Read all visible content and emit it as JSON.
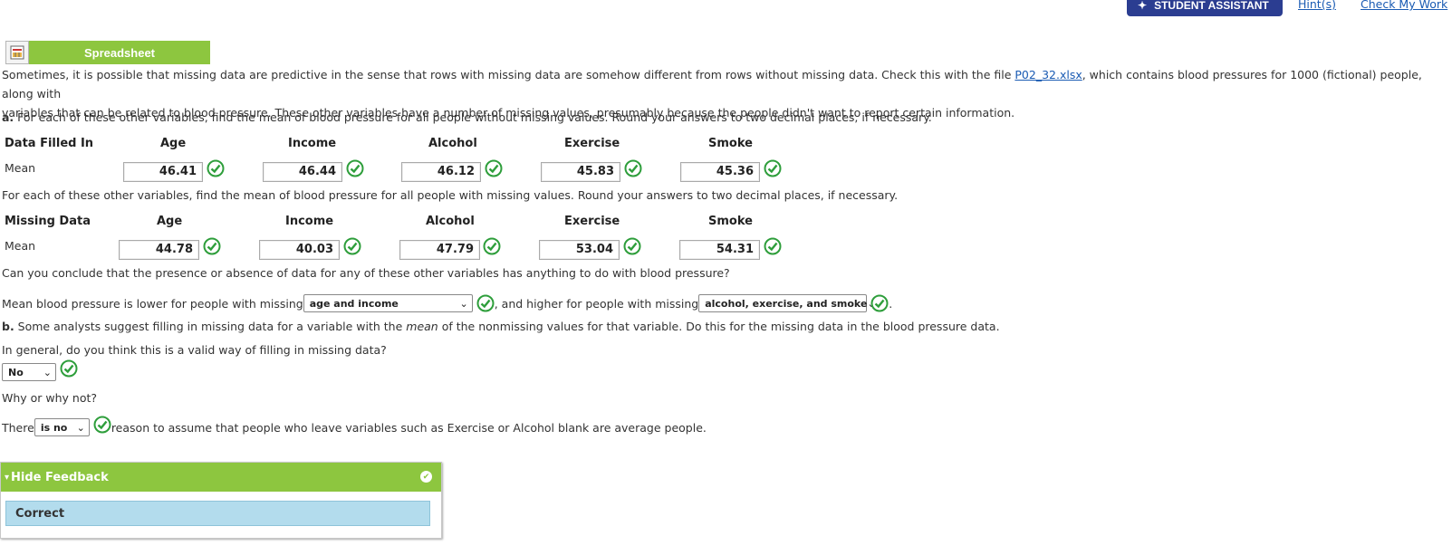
{
  "top": {
    "assistant_label": "STUDENT ASSISTANT",
    "hints_label": "Hint(s)",
    "check_label": "Check My Work"
  },
  "spreadsheet_label": "Spreadsheet",
  "intro": {
    "line1_a": "Sometimes, it is possible that missing data are predictive in the sense that rows with missing data are somehow different from rows without missing data. Check this with the file ",
    "file_link": "P02_32.xlsx",
    "line1_b": ", which contains blood pressures for 1000 (fictional) people, along with",
    "line2": "variables that can be related to blood pressure. These other variables have a number of missing values, presumably because the people didn't want to report certain information."
  },
  "part_a": {
    "label": "a.",
    "text": " For each of these other variables, find the mean of blood pressure for all people without missing values. Round your answers to two decimal places, if necessary."
  },
  "table1": {
    "row_header": "Data Filled In",
    "columns": [
      "Age",
      "Income",
      "Alcohol",
      "Exercise",
      "Smoke"
    ],
    "row_label": "Mean",
    "values": [
      "46.41",
      "46.44",
      "46.12",
      "45.83",
      "45.36"
    ]
  },
  "mid_text": "For each of these other variables, find the mean of blood pressure for all people with missing values. Round your answers to two decimal places, if necessary.",
  "table2": {
    "row_header": "Missing Data",
    "columns": [
      "Age",
      "Income",
      "Alcohol",
      "Exercise",
      "Smoke"
    ],
    "row_label": "Mean",
    "values": [
      "44.78",
      "40.03",
      "47.79",
      "53.04",
      "54.31"
    ]
  },
  "question_conclude": "Can you conclude that the presence or absence of data for any of these other variables has anything to do with blood pressure?",
  "sentence": {
    "a": "Mean blood pressure is lower for people with missing ",
    "select1": "age and income",
    "b": ", and higher for people with missing ",
    "select2": "alcohol, exercise, and smoke",
    "c": "."
  },
  "part_b": {
    "label": "b.",
    "text_a": " Some analysts suggest filling in missing data for a variable with the ",
    "text_em": "mean",
    "text_b": " of the nonmissing values for that variable. Do this for the missing data in the blood pressure data."
  },
  "q_general": "In general, do you think this is a valid way of filling in missing data?",
  "select_no": "No",
  "q_why": "Why or why not?",
  "there": {
    "a": "There ",
    "select": "is no",
    "b": " reason to assume that people who leave variables such as Exercise or Alcohol blank are average people."
  },
  "feedback": {
    "toggle": "Hide Feedback",
    "arrow": "▾",
    "result": "Correct"
  },
  "colors": {
    "green": "#8dc63f",
    "check": "#2e9e3b",
    "assistant": "#2b3d91",
    "link": "#1a5bb3"
  }
}
